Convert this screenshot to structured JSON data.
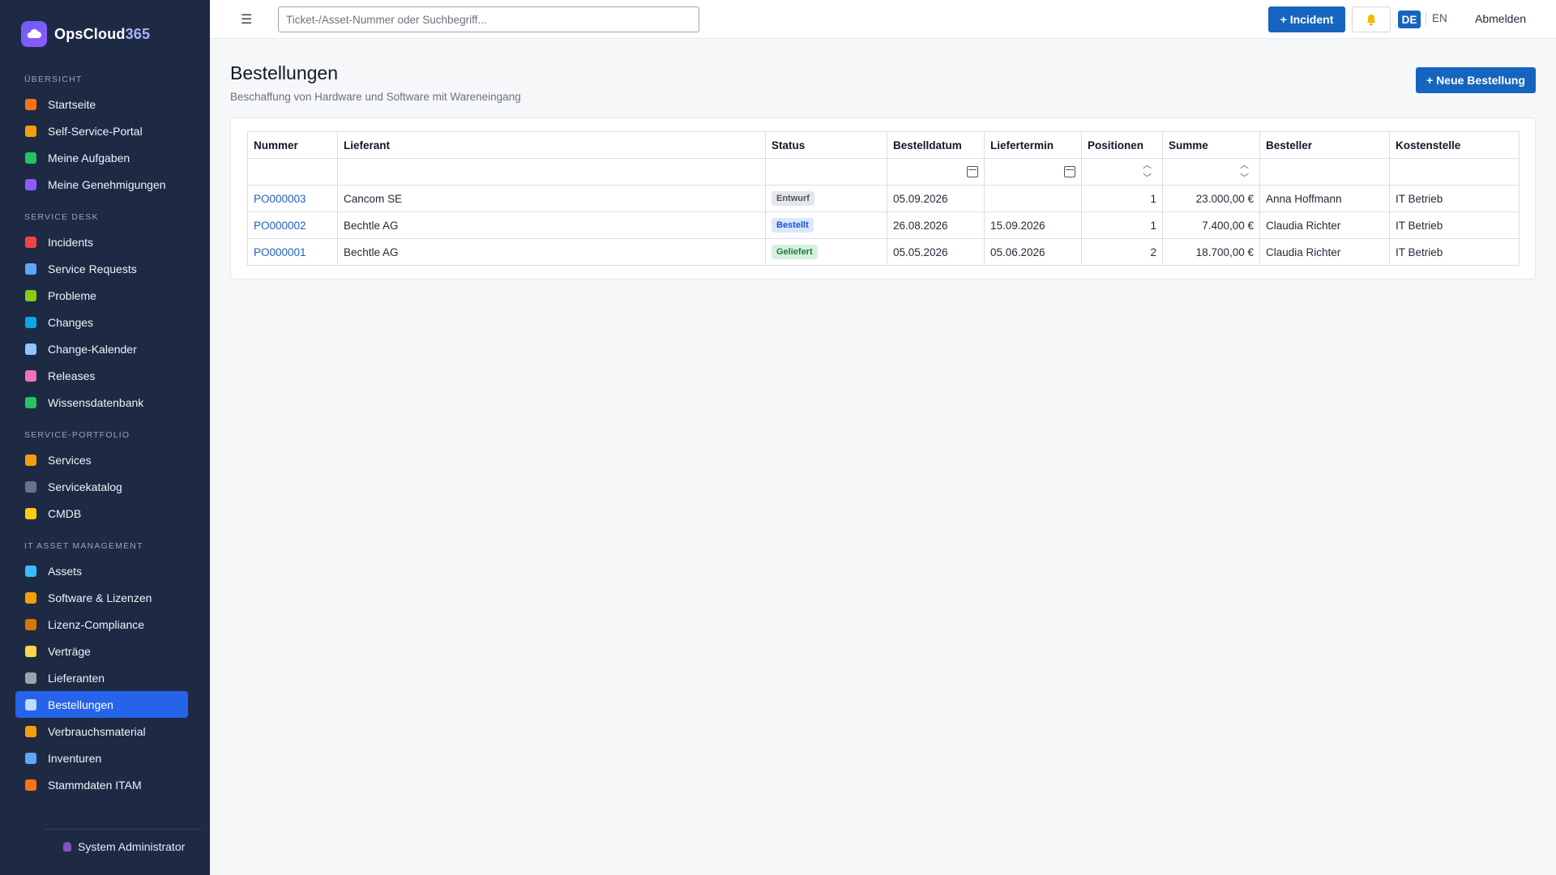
{
  "brand": {
    "name": "OpsCloud",
    "accent": "365"
  },
  "sidebar": {
    "sections": [
      {
        "title": "ÜBERSICHT",
        "items": [
          {
            "label": "Startseite",
            "icon": "house-icon",
            "color": "#f97316"
          },
          {
            "label": "Self-Service-Portal",
            "icon": "person-icon",
            "color": "#f59e0b"
          },
          {
            "label": "Meine Aufgaben",
            "icon": "checkbox-icon",
            "color": "#22c55e"
          },
          {
            "label": "Meine Genehmigungen",
            "icon": "checkmark-icon",
            "color": "#8b5cf6"
          }
        ]
      },
      {
        "title": "SERVICE DESK",
        "items": [
          {
            "label": "Incidents",
            "icon": "siren-icon",
            "color": "#ef4444"
          },
          {
            "label": "Service Requests",
            "icon": "inbox-icon",
            "color": "#60a5fa"
          },
          {
            "label": "Probleme",
            "icon": "puzzle-icon",
            "color": "#84cc16"
          },
          {
            "label": "Changes",
            "icon": "cycle-icon",
            "color": "#0ea5e9"
          },
          {
            "label": "Change-Kalender",
            "icon": "calendar-icon",
            "color": "#93c5fd"
          },
          {
            "label": "Releases",
            "icon": "rocket-icon",
            "color": "#f472b6"
          },
          {
            "label": "Wissensdatenbank",
            "icon": "books-icon",
            "color": "#22c55e"
          }
        ]
      },
      {
        "title": "SERVICE-PORTFOLIO",
        "items": [
          {
            "label": "Services",
            "icon": "bell-icon",
            "color": "#f59e0b"
          },
          {
            "label": "Servicekatalog",
            "icon": "catalog-icon",
            "color": "#64748b"
          },
          {
            "label": "CMDB",
            "icon": "folder-icon",
            "color": "#facc15"
          }
        ]
      },
      {
        "title": "IT ASSET MANAGEMENT",
        "items": [
          {
            "label": "Assets",
            "icon": "laptop-icon",
            "color": "#38bdf8"
          },
          {
            "label": "Software & Lizenzen",
            "icon": "disc-icon",
            "color": "#f59e0b"
          },
          {
            "label": "Lizenz-Compliance",
            "icon": "scales-icon",
            "color": "#d97706"
          },
          {
            "label": "Verträge",
            "icon": "scroll-icon",
            "color": "#fcd34d"
          },
          {
            "label": "Lieferanten",
            "icon": "building-icon",
            "color": "#9ca3af"
          },
          {
            "label": "Bestellungen",
            "icon": "receipt-icon",
            "color": "#bfdbfe",
            "active": true
          },
          {
            "label": "Verbrauchsmaterial",
            "icon": "package-icon",
            "color": "#f59e0b"
          },
          {
            "label": "Inventuren",
            "icon": "magnifier-icon",
            "color": "#60a5fa"
          },
          {
            "label": "Stammdaten ITAM",
            "icon": "bricks-icon",
            "color": "#f97316"
          }
        ]
      }
    ],
    "user": "System Administrator"
  },
  "topbar": {
    "search_placeholder": "Ticket-/Asset-Nummer oder Suchbegriff...",
    "incident_button": "+ Incident",
    "lang_de": "DE",
    "lang_en": "EN",
    "logout": "Abmelden"
  },
  "page": {
    "title": "Bestellungen",
    "subtitle": "Beschaffung von Hardware und Software mit Wareneingang",
    "new_button": "+ Neue Bestellung"
  },
  "table": {
    "columns": [
      "Nummer",
      "Lieferant",
      "Status",
      "Bestelldatum",
      "Liefertermin",
      "Positionen",
      "Summe",
      "Besteller",
      "Kostenstelle"
    ],
    "rows": [
      {
        "nummer": "PO000003",
        "lieferant": "Cancom SE",
        "status": "Entwurf",
        "status_kind": "draft",
        "bestelldatum": "05.09.2026",
        "liefertermin": "",
        "positionen": "1",
        "summe": "23.000,00 €",
        "besteller": "Anna Hoffmann",
        "kostenstelle": "IT Betrieb"
      },
      {
        "nummer": "PO000002",
        "lieferant": "Bechtle AG",
        "status": "Bestellt",
        "status_kind": "ordered",
        "bestelldatum": "26.08.2026",
        "liefertermin": "15.09.2026",
        "positionen": "1",
        "summe": "7.400,00 €",
        "besteller": "Claudia Richter",
        "kostenstelle": "IT Betrieb"
      },
      {
        "nummer": "PO000001",
        "lieferant": "Bechtle AG",
        "status": "Geliefert",
        "status_kind": "delivered",
        "bestelldatum": "05.05.2026",
        "liefertermin": "05.06.2026",
        "positionen": "2",
        "summe": "18.700,00 €",
        "besteller": "Claudia Richter",
        "kostenstelle": "IT Betrieb"
      }
    ]
  }
}
